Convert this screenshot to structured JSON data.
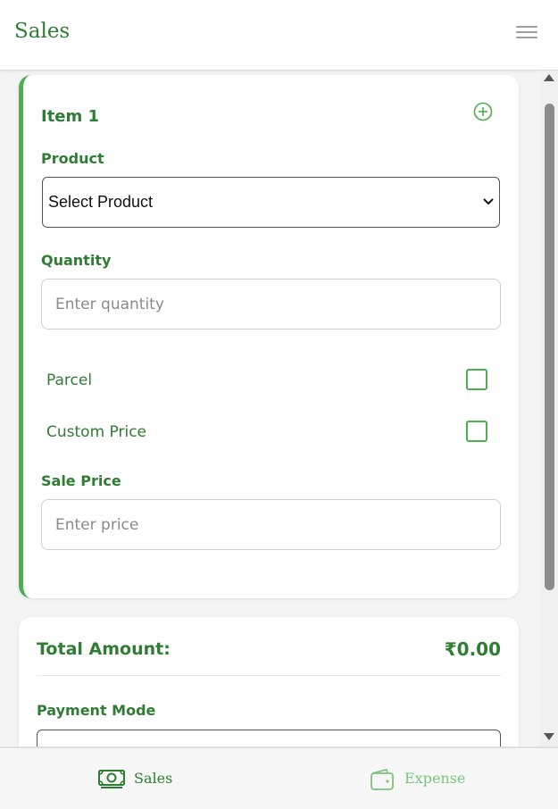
{
  "app": {
    "title": "Sales"
  },
  "item": {
    "title": "Item 1",
    "product_label": "Product",
    "product_selected": "Select Product",
    "quantity_label": "Quantity",
    "quantity_placeholder": "Enter quantity",
    "parcel_label": "Parcel",
    "custom_price_label": "Custom Price",
    "sale_price_label": "Sale Price",
    "sale_price_placeholder": "Enter price"
  },
  "summary": {
    "total_label": "Total Amount:",
    "total_value": "₹0.00",
    "payment_mode_label": "Payment Mode"
  },
  "nav": {
    "sales_label": "Sales",
    "expense_label": "Expense"
  },
  "colors": {
    "primary": "#2e7d32",
    "accent": "#4caf50",
    "inactive_nav": "#7cc47f"
  }
}
